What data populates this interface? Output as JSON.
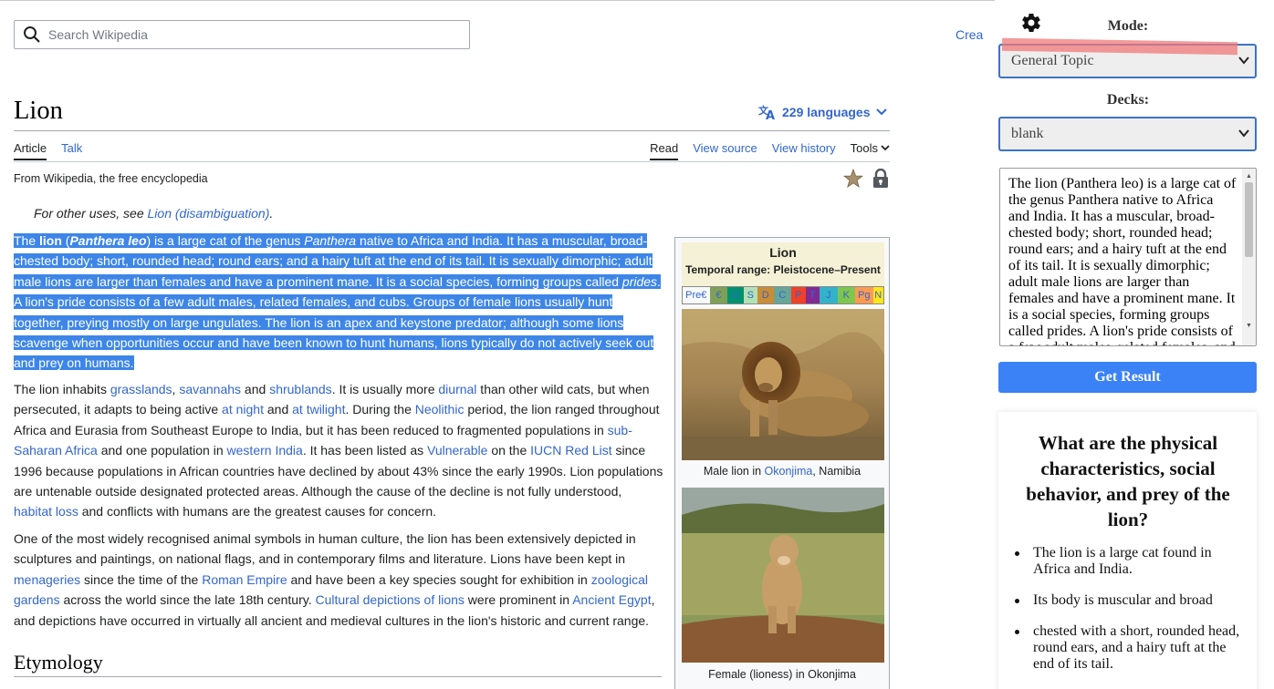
{
  "search": {
    "placeholder": "Search Wikipedia"
  },
  "header": {
    "create_label": "Crea"
  },
  "article": {
    "title": "Lion",
    "languages": "229 languages",
    "tabs_left": [
      "Article",
      "Talk"
    ],
    "tabs_right": [
      "Read",
      "View source",
      "View history",
      "Tools"
    ],
    "from": "From Wikipedia, the free encyclopedia",
    "hatnote_prefix": "For other uses, see ",
    "hatnote_link": "Lion (disambiguation)",
    "hatnote_suffix": ".",
    "p1": {
      "s1": "The ",
      "s2": "lion",
      "s3": " (",
      "s4": "Panthera leo",
      "s5": ") is a large cat of the genus ",
      "s6": "Panthera",
      "s7": " native to Africa and India. It has a muscular, broad-chested body; short, rounded head; round ears; and a hairy tuft at the end of its tail. It is sexually dimorphic; adult male lions are larger than females and have a prominent mane. It is a social species, forming groups called ",
      "s8": "prides",
      "s9": ". A lion's pride consists of a few adult males, related females, and cubs. Groups of female lions usually hunt together, preying mostly on large ungulates. The lion is an apex and keystone predator; although some lions scavenge when opportunities occur and have been known to hunt humans, lions typically do not actively seek out and prey on humans."
    },
    "p2": {
      "t1": "The lion inhabits ",
      "l1": "grasslands",
      "t2": ", ",
      "l2": "savannahs",
      "t3": " and ",
      "l3": "shrublands",
      "t4": ". It is usually more ",
      "l4": "diurnal",
      "t5": " than other wild cats, but when persecuted, it adapts to being active ",
      "l5": "at night",
      "t6": " and ",
      "l6": "at twilight",
      "t7": ". During the ",
      "l7": "Neolithic",
      "t8": " period, the lion ranged throughout Africa and Eurasia from Southeast Europe to India, but it has been reduced to fragmented populations in ",
      "l8": "sub-Saharan Africa",
      "t9": " and one population in ",
      "l9": "western India",
      "t10": ". It has been listed as ",
      "l10": "Vulnerable",
      "t11": " on the ",
      "l11": "IUCN Red List",
      "t12": " since 1996 because populations in African countries have declined by about 43% since the early 1990s. Lion populations are untenable outside designated protected areas. Although the cause of the decline is not fully understood, ",
      "l12": "habitat loss",
      "t13": " and conflicts with humans are the greatest causes for concern."
    },
    "p3": {
      "t1": "One of the most widely recognised animal symbols in human culture, the lion has been extensively depicted in sculptures and paintings, on national flags, and in contemporary films and literature. Lions have been kept in ",
      "l1": "menageries",
      "t2": " since the time of the ",
      "l2": "Roman Empire",
      "t3": " and have been a key species sought for exhibition in ",
      "l3": "zoological gardens",
      "t4": " across the world since the late 18th century. ",
      "l4": "Cultural depictions of lions",
      "t5": " were prominent in ",
      "l5": "Ancient Egypt",
      "t6": ", and depictions have occurred in virtually all ancient and medieval cultures in the lion's historic and current range."
    },
    "etymology": "Etymology",
    "infobox": {
      "name": "Lion",
      "range": "Temporal range: Pleistocene–Present",
      "periods": [
        "Pre€",
        "€",
        "O",
        "S",
        "D",
        "C",
        "P",
        "T",
        "J",
        "K",
        "Pg",
        "N"
      ],
      "period_colors": [
        "#f8f9fa",
        "#7fa056",
        "#009270",
        "#b3e1b6",
        "#cb8c37",
        "#67a599",
        "#f04028",
        "#812b92",
        "#34b2c9",
        "#7fc64e",
        "#fd9a52",
        "#ffe619"
      ],
      "caption1_prefix": "Male lion in ",
      "caption1_link": "Okonjima",
      "caption1_suffix": ", Namibia",
      "caption2": "Female (lioness) in Okonjima"
    }
  },
  "panel": {
    "mode_label": "Mode:",
    "mode_value": "General Topic",
    "decks_label": "Decks:",
    "decks_value": "blank",
    "text": "The lion (Panthera leo) is a large cat of the genus Panthera native to Africa and India. It has a muscular, broad-chested body; short, rounded head; round ears; and a hairy tuft at the end of its tail. It is sexually dimorphic; adult male lions are larger than females and have a prominent mane. It is a social species, forming groups called prides. A lion's pride consists of a few adult males, related females, and cubs.",
    "get_result": "Get Result",
    "question": "What are the physical characteristics, social behavior, and prey of the lion?",
    "answers": [
      "The lion is a large cat found in Africa and India.",
      "Its body is muscular and broad",
      "chested with a short, rounded head, round ears, and a hairy tuft at the end of its tail."
    ]
  },
  "colors": {
    "link": "#3366cc",
    "selection": "#3d86e8",
    "accent": "#3b82f6",
    "mark": "#f07878"
  }
}
